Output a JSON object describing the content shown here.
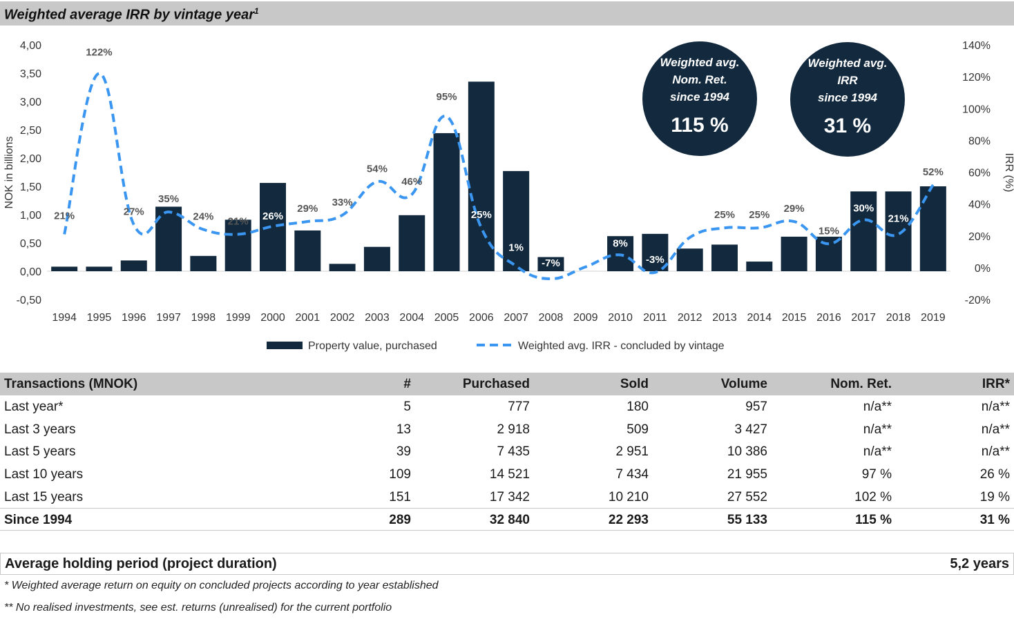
{
  "title": "Weighted average IRR by vintage year",
  "title_sup": "1",
  "colors": {
    "bar": "#132a3e",
    "line": "#3a96f0",
    "circle": "#132a3e",
    "header_bg": "#c8c8c8"
  },
  "chart_data": {
    "type": "bar",
    "categories": [
      "1994",
      "1995",
      "1996",
      "1997",
      "1998",
      "1999",
      "2000",
      "2001",
      "2002",
      "2003",
      "2004",
      "2005",
      "2006",
      "2007",
      "2008",
      "2009",
      "2010",
      "2011",
      "2012",
      "2013",
      "2014",
      "2015",
      "2016",
      "2017",
      "2018",
      "2019"
    ],
    "series": [
      {
        "name": "Property value, purchased",
        "type": "bar",
        "axis": "left",
        "values": [
          0.08,
          0.08,
          0.19,
          1.14,
          0.27,
          0.91,
          1.56,
          0.72,
          0.13,
          0.43,
          0.99,
          2.44,
          3.35,
          1.77,
          0.25,
          0,
          0.62,
          0.66,
          0.4,
          0.47,
          0.17,
          0.61,
          0.61,
          1.41,
          1.41,
          1.5
        ]
      },
      {
        "name": "Weighted avg. IRR - concluded by vintage",
        "type": "line",
        "axis": "right",
        "values": [
          21,
          122,
          27,
          35,
          24,
          21,
          26,
          29,
          33,
          54,
          46,
          95,
          25,
          1,
          -7,
          null,
          8,
          -3,
          19,
          25,
          25,
          29,
          15,
          30,
          21,
          52
        ]
      }
    ],
    "point_labels": [
      "21%",
      "122%",
      "27%",
      "35%",
      "24%",
      "21%",
      "26%",
      "29%",
      "33%",
      "54%",
      "46%",
      "95%",
      "25%",
      "1%",
      "-7%",
      "",
      "8%",
      "-3%",
      "",
      "25%",
      "25%",
      "29%",
      "15%",
      "30%",
      "21%",
      "52%"
    ],
    "ylabel": "NOK in billions",
    "y2label": "IRR (%)",
    "ylim": [
      -0.5,
      4.0
    ],
    "y_ticks": [
      "-0,50",
      "0,00",
      "0,50",
      "1,00",
      "1,50",
      "2,00",
      "2,50",
      "3,00",
      "3,50",
      "4,00"
    ],
    "y2lim": [
      -20,
      140
    ],
    "y2_ticks": [
      "-20%",
      "0%",
      "20%",
      "40%",
      "60%",
      "80%",
      "100%",
      "120%",
      "140%"
    ],
    "legend": [
      "Property value, purchased",
      "Weighted avg. IRR - concluded by vintage"
    ],
    "legend_position": "bottom"
  },
  "circles": [
    {
      "line1": "Weighted avg.",
      "line2": "Nom. Ret.",
      "line3": "since 1994",
      "value": "115 %"
    },
    {
      "line1": "Weighted avg.",
      "line2": "IRR",
      "line3": "since 1994",
      "value": "31 %"
    }
  ],
  "table": {
    "headers": [
      "Transactions (MNOK)",
      "#",
      "Purchased",
      "Sold",
      "Volume",
      "Nom. Ret.",
      "IRR*"
    ],
    "rows": [
      [
        "Last year*",
        "5",
        "777",
        "180",
        "957",
        "n/a**",
        "n/a**"
      ],
      [
        "Last 3 years",
        "13",
        "2 918",
        "509",
        "3 427",
        "n/a**",
        "n/a**"
      ],
      [
        "Last 5 years",
        "39",
        "7 435",
        "2 951",
        "10 386",
        "n/a**",
        "n/a**"
      ],
      [
        "Last 10 years",
        "109",
        "14 521",
        "7 434",
        "21 955",
        "97 %",
        "26 %"
      ],
      [
        "Last 15 years",
        "151",
        "17 342",
        "10 210",
        "27 552",
        "102 %",
        "19 %"
      ],
      [
        "Since 1994",
        "289",
        "32 840",
        "22 293",
        "55 133",
        "115 %",
        "31 %"
      ]
    ]
  },
  "holding": {
    "label": "Average holding period (project duration)",
    "value": "5,2 years"
  },
  "notes": [
    "* Weighted average return on equity on concluded projects according to year established",
    "** No realised investments, see est. returns (unrealised) for the current portfolio"
  ]
}
